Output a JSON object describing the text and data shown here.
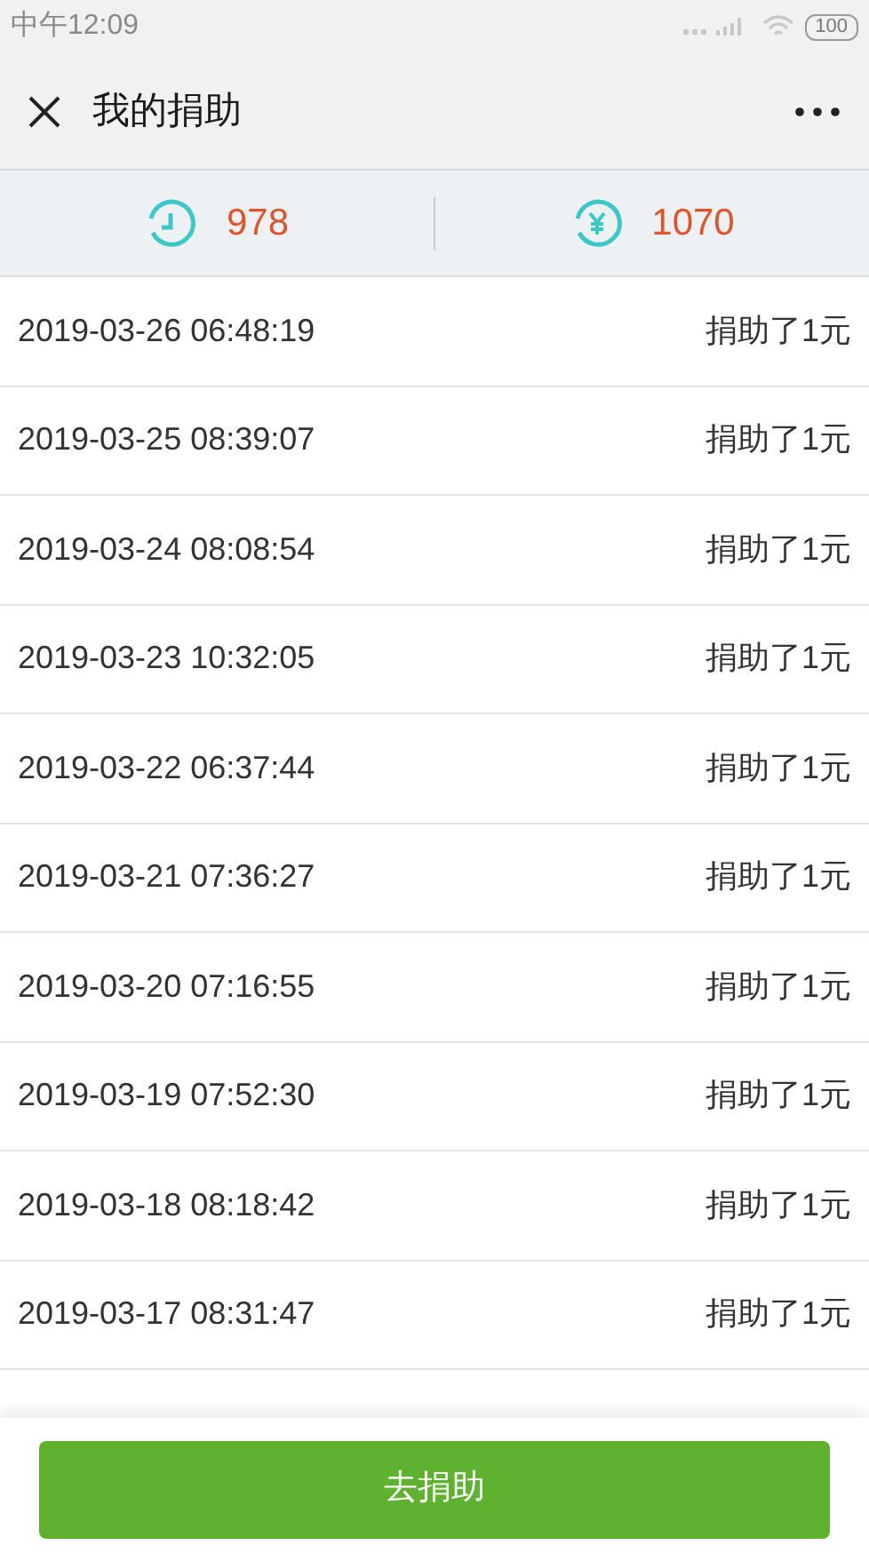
{
  "status_bar": {
    "time": "中午12:09",
    "battery": "100"
  },
  "header": {
    "title": "我的捐助"
  },
  "stats": [
    {
      "kind": "clock",
      "value": "978"
    },
    {
      "kind": "yuan",
      "value": "1070"
    }
  ],
  "records": [
    {
      "time": "2019-03-26 06:48:19",
      "text": "捐助了1元"
    },
    {
      "time": "2019-03-25 08:39:07",
      "text": "捐助了1元"
    },
    {
      "time": "2019-03-24 08:08:54",
      "text": "捐助了1元"
    },
    {
      "time": "2019-03-23 10:32:05",
      "text": "捐助了1元"
    },
    {
      "time": "2019-03-22 06:37:44",
      "text": "捐助了1元"
    },
    {
      "time": "2019-03-21 07:36:27",
      "text": "捐助了1元"
    },
    {
      "time": "2019-03-20 07:16:55",
      "text": "捐助了1元"
    },
    {
      "time": "2019-03-19 07:52:30",
      "text": "捐助了1元"
    },
    {
      "time": "2019-03-18 08:18:42",
      "text": "捐助了1元"
    },
    {
      "time": "2019-03-17 08:31:47",
      "text": "捐助了1元"
    }
  ],
  "button": {
    "label": "去捐助"
  }
}
